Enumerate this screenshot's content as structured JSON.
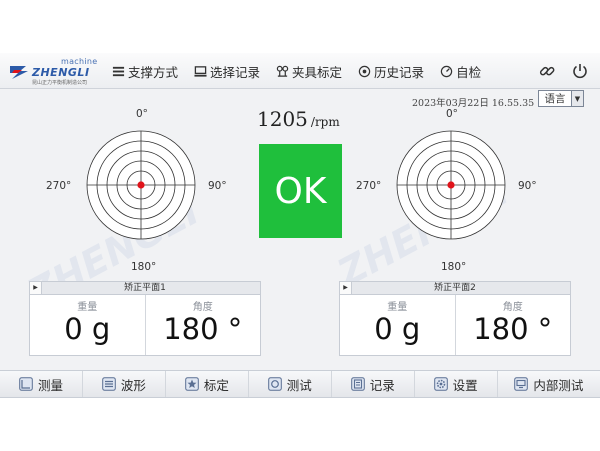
{
  "header": {
    "logo_word": "ZHENGLI",
    "logo_machine": "machine",
    "logo_sub": "昆山正力平衡机制造公司",
    "nav": [
      {
        "label": "支撑方式",
        "icon": "list-icon"
      },
      {
        "label": "选择记录",
        "icon": "monitor-icon"
      },
      {
        "label": "夹具标定",
        "icon": "fixture-icon"
      },
      {
        "label": "历史记录",
        "icon": "history-icon"
      },
      {
        "label": "自检",
        "icon": "self-check-icon"
      }
    ]
  },
  "status": {
    "datetime": "2023年03月22日  16.55.35",
    "language": "语言"
  },
  "speed": {
    "value": "1205",
    "unit": "/rpm"
  },
  "result": "OK",
  "polar_labels": {
    "top": "0°",
    "right": "90°",
    "bottom": "180°",
    "left": "270°"
  },
  "planes": [
    {
      "title": "矫正平面1",
      "weight_label": "重量",
      "angle_label": "角度",
      "weight": "0 g",
      "angle": "180 °"
    },
    {
      "title": "矫正平面2",
      "weight_label": "重量",
      "angle_label": "角度",
      "weight": "0 g",
      "angle": "180 °"
    }
  ],
  "footer": [
    {
      "label": "测量",
      "icon": "measure-icon"
    },
    {
      "label": "波形",
      "icon": "waveform-icon"
    },
    {
      "label": "标定",
      "icon": "star-icon"
    },
    {
      "label": "测试",
      "icon": "test-icon"
    },
    {
      "label": "记录",
      "icon": "record-icon"
    },
    {
      "label": "设置",
      "icon": "gear-icon"
    },
    {
      "label": "内部测试",
      "icon": "internal-test-icon"
    }
  ],
  "colors": {
    "ok_green": "#1fbf3c",
    "point_red": "#e0131a",
    "brand_blue": "#2c5aa8"
  }
}
